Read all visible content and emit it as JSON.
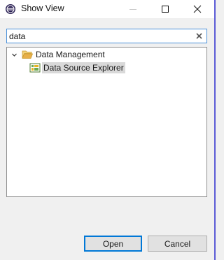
{
  "window": {
    "title": "Show View",
    "app_icon": "eclipse-icon",
    "controls": {
      "minimize": "minimize-icon",
      "maximize": "maximize-icon",
      "close": "close-icon"
    }
  },
  "filter": {
    "value": "data",
    "clear_icon": "clear-icon"
  },
  "tree": {
    "category": {
      "label": "Data Management",
      "expanded": true,
      "icon": "folder-open-icon"
    },
    "items": [
      {
        "label": "Data Source Explorer",
        "selected": true,
        "icon": "data-source-explorer-icon"
      }
    ]
  },
  "buttons": {
    "open_label": "Open",
    "cancel_label": "Cancel"
  },
  "colors": {
    "focus": "#0078d7",
    "selection": "#d9d9d9",
    "folder": "#e8b04a"
  }
}
